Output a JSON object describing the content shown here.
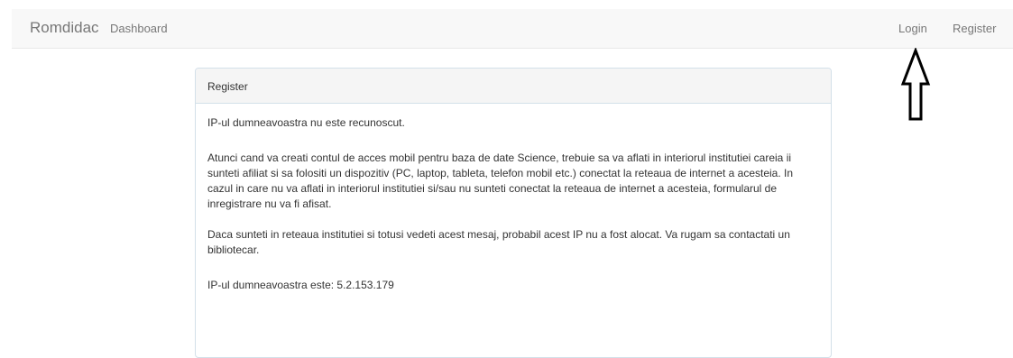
{
  "navbar": {
    "brand": "Romdidac",
    "links": {
      "dashboard": "Dashboard",
      "login": "Login",
      "register": "Register"
    }
  },
  "panel": {
    "heading": "Register",
    "paragraphs": {
      "ip_unknown": "IP-ul dumneavoastra nu este recunoscut.",
      "instructions": "Atunci cand va creati contul de acces mobil pentru baza de date Science, trebuie sa va aflati in interiorul institutiei careia ii sunteti afiliat si sa folositi un dispozitiv (PC, laptop, tableta, telefon mobil etc.) conectat la reteaua de internet a acesteia. In cazul in care nu va aflati in interiorul institutiei si/sau nu sunteti conectat la reteaua de internet a acesteia, formularul de inregistrare nu va fi afisat.",
      "contact": "Daca sunteti in reteaua institutiei si totusi vedeti acest mesaj, probabil acest IP nu a fost alocat. Va rugam sa contactati un bibliotecar.",
      "ip_address": "IP-ul dumneavoastra este: 5.2.153.179"
    }
  },
  "annotation": {
    "icon": "up-arrow-icon",
    "color": "#000000"
  }
}
